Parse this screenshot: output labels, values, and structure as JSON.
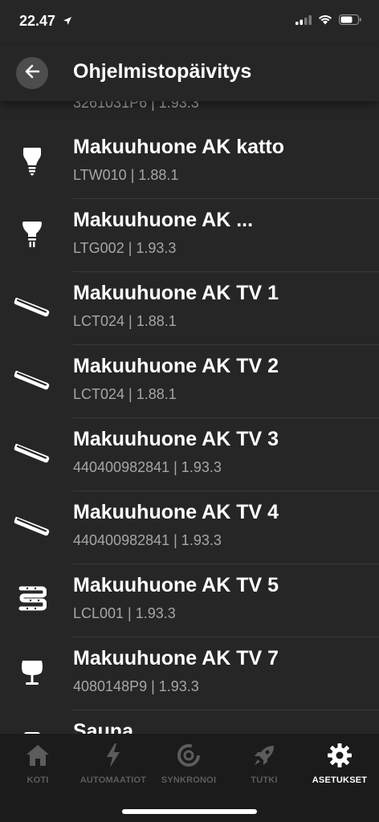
{
  "status": {
    "time": "22.47"
  },
  "header": {
    "title": "Ohjelmistopäivitys"
  },
  "list": {
    "partial_top": "3261031P6 | 1.93.3",
    "items": [
      {
        "name": "Makuuhuone AK katto",
        "detail": "LTW010 | 1.88.1",
        "icon": "bulb-icon"
      },
      {
        "name": "Makuuhuone AK ...",
        "detail": "LTG002 | 1.93.3",
        "icon": "spot-bulb-icon"
      },
      {
        "name": "Makuuhuone AK TV 1",
        "detail": "LCT024 | 1.88.1",
        "icon": "light-bar-icon"
      },
      {
        "name": "Makuuhuone AK TV 2",
        "detail": "LCT024 | 1.88.1",
        "icon": "light-bar-icon"
      },
      {
        "name": "Makuuhuone AK TV 3",
        "detail": "440400982841 | 1.93.3",
        "icon": "light-bar-icon"
      },
      {
        "name": "Makuuhuone AK TV 4",
        "detail": "440400982841 | 1.93.3",
        "icon": "light-bar-icon"
      },
      {
        "name": "Makuuhuone AK TV 5",
        "detail": "LCL001 | 1.93.3",
        "icon": "lightstrip-icon"
      },
      {
        "name": "Makuuhuone AK TV 7",
        "detail": "4080148P9 | 1.93.3",
        "icon": "table-lamp-icon"
      }
    ],
    "partial_bottom": "Sauna"
  },
  "tabs": [
    {
      "label": "KOTI",
      "icon": "home-icon",
      "active": false
    },
    {
      "label": "AUTOMAATIOT",
      "icon": "lightning-icon",
      "active": false
    },
    {
      "label": "SYNKRONOI",
      "icon": "sync-icon",
      "active": false
    },
    {
      "label": "TUTKI",
      "icon": "rocket-icon",
      "active": false
    },
    {
      "label": "ASETUKSET",
      "icon": "gear-icon",
      "active": true
    }
  ],
  "colors": {
    "background": "#262626",
    "tabbar": "#1b1b1b",
    "inactive_tab": "#5c5c5c",
    "active_tab": "#ffffff"
  }
}
